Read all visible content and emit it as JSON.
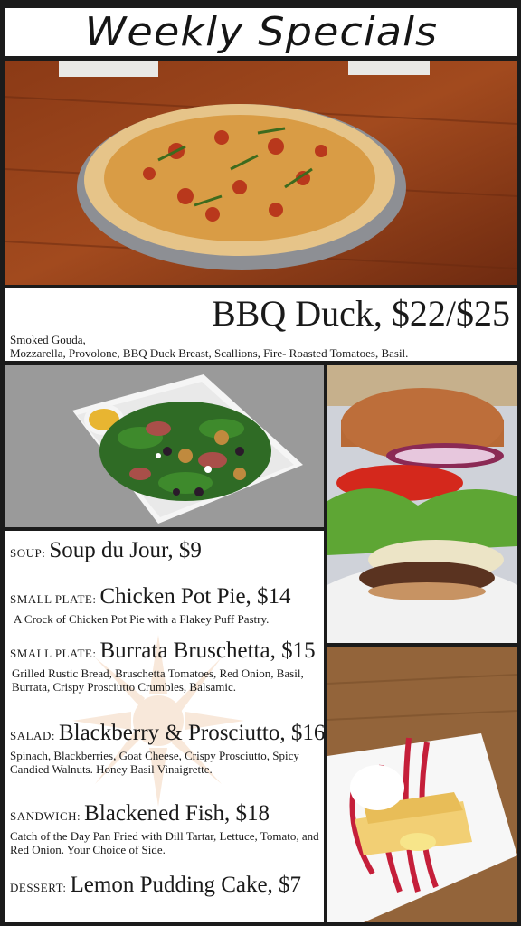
{
  "header": {
    "title": "Weekly Specials"
  },
  "featured": {
    "title": "BBQ Duck, $22/$25",
    "description": "Smoked Gouda,\nMozzarella, Provolone, BBQ Duck Breast, Scallions, Fire- Roasted Tomatoes, Basil."
  },
  "menu": {
    "items": [
      {
        "category": "Soup:",
        "name": "Soup du Jour, $9",
        "description": ""
      },
      {
        "category": "Small Plate:",
        "name": "Chicken Pot Pie, $14",
        "description": "A Crock of Chicken Pot Pie with a Flakey Puff Pastry."
      },
      {
        "category": "Small Plate:",
        "name": "Burrata Bruschetta, $15",
        "description": "Grilled Rustic Bread, Bruschetta Tomatoes, Red Onion, Basil, Burrata, Crispy Prosciutto Crumbles, Balsamic."
      },
      {
        "category": "Salad:",
        "name": "Blackberry & Prosciutto, $16",
        "description": "Spinach, Blackberries, Goat Cheese, Crispy Prosciutto, Spicy Candied Walnuts. Honey Basil Vinaigrette."
      },
      {
        "category": "Sandwich:",
        "name": "Blackened Fish, $18",
        "description": "Catch of the Day Pan Fried with Dill Tartar, Lettuce, Tomato, and Red Onion. Your Choice of Side."
      },
      {
        "category": "Dessert:",
        "name": "Lemon Pudding Cake, $7",
        "description": ""
      }
    ]
  },
  "colors": {
    "text": "#1a1a1a",
    "panel": "#ffffff",
    "background": "#1b1b1b"
  }
}
